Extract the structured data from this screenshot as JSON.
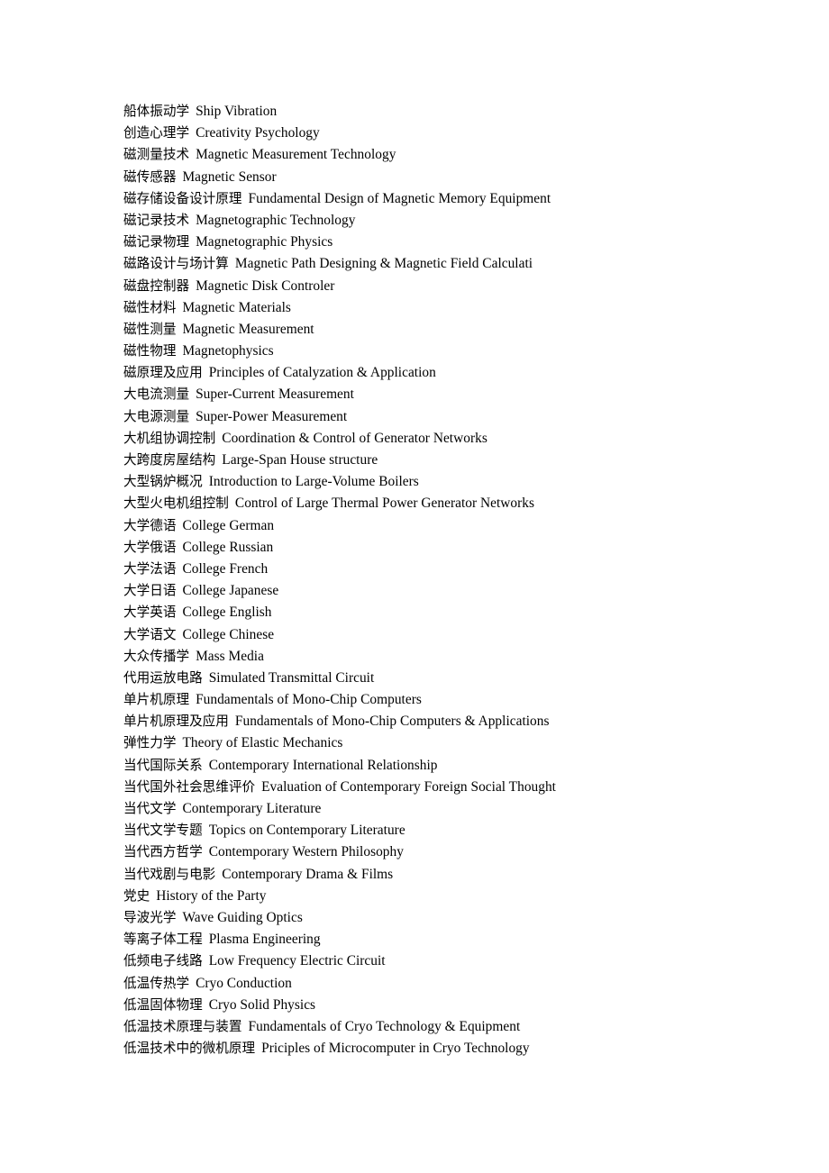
{
  "document": {
    "type": "bilingual-glossary",
    "page_background": "#ffffff",
    "text_color": "#000000",
    "entries": [
      {
        "zh": "船体振动学",
        "en": "Ship Vibration"
      },
      {
        "zh": "创造心理学",
        "en": "Creativity Psychology"
      },
      {
        "zh": "磁测量技术",
        "en": "Magnetic Measurement Technology"
      },
      {
        "zh": "磁传感器",
        "en": "Magnetic Sensor"
      },
      {
        "zh": "磁存储设备设计原理",
        "en": "Fundamental Design of Magnetic Memory Equipment"
      },
      {
        "zh": "磁记录技术",
        "en": "Magnetographic Technology"
      },
      {
        "zh": "磁记录物理",
        "en": "Magnetographic Physics"
      },
      {
        "zh": "磁路设计与场计算",
        "en": "Magnetic Path Designing & Magnetic Field Calculati"
      },
      {
        "zh": "磁盘控制器",
        "en": "Magnetic Disk Controler"
      },
      {
        "zh": "磁性材料",
        "en": "Magnetic Materials"
      },
      {
        "zh": "磁性测量",
        "en": "Magnetic Measurement"
      },
      {
        "zh": "磁性物理",
        "en": "Magnetophysics"
      },
      {
        "zh": "磁原理及应用",
        "en": "Principles of Catalyzation & Application"
      },
      {
        "zh": "大电流测量",
        "en": "Super-Current Measurement"
      },
      {
        "zh": "大电源测量",
        "en": "Super-Power Measurement"
      },
      {
        "zh": "大机组协调控制",
        "en": "Coordination & Control of Generator Networks"
      },
      {
        "zh": "大跨度房屋结构",
        "en": "Large-Span House structure"
      },
      {
        "zh": "大型锅炉概况",
        "en": "Introduction to Large-Volume Boilers"
      },
      {
        "zh": "大型火电机组控制",
        "en": "Control of Large Thermal Power Generator Networks"
      },
      {
        "zh": "大学德语",
        "en": "College German"
      },
      {
        "zh": "大学俄语",
        "en": "College Russian"
      },
      {
        "zh": "大学法语",
        "en": "College French"
      },
      {
        "zh": "大学日语",
        "en": "College Japanese"
      },
      {
        "zh": "大学英语",
        "en": "College English"
      },
      {
        "zh": "大学语文",
        "en": "College Chinese"
      },
      {
        "zh": "大众传播学",
        "en": "Mass Media"
      },
      {
        "zh": "代用运放电路",
        "en": "Simulated Transmittal Circuit"
      },
      {
        "zh": "单片机原理",
        "en": "Fundamentals of Mono-Chip Computers"
      },
      {
        "zh": "单片机原理及应用",
        "en": "Fundamentals of Mono-Chip Computers & Applications"
      },
      {
        "zh": "弹性力学",
        "en": "Theory of Elastic Mechanics"
      },
      {
        "zh": "当代国际关系",
        "en": "Contemporary International Relationship"
      },
      {
        "zh": "当代国外社会思维评价",
        "en": "Evaluation of Contemporary Foreign Social Thought"
      },
      {
        "zh": "当代文学",
        "en": "Contemporary Literature"
      },
      {
        "zh": "当代文学专题",
        "en": "Topics on Contemporary Literature"
      },
      {
        "zh": "当代西方哲学",
        "en": "Contemporary Western Philosophy"
      },
      {
        "zh": "当代戏剧与电影",
        "en": "Contemporary Drama & Films"
      },
      {
        "zh": "党史",
        "en": "History of the Party"
      },
      {
        "zh": "导波光学",
        "en": "Wave Guiding Optics"
      },
      {
        "zh": "等离子体工程",
        "en": "Plasma Engineering"
      },
      {
        "zh": "低频电子线路",
        "en": "Low Frequency Electric Circuit"
      },
      {
        "zh": "低温传热学",
        "en": "Cryo Conduction"
      },
      {
        "zh": "低温固体物理",
        "en": "Cryo Solid Physics"
      },
      {
        "zh": "低温技术原理与装置",
        "en": "Fundamentals of Cryo Technology & Equipment"
      },
      {
        "zh": "低温技术中的微机原理",
        "en": "Priciples of Microcomputer in Cryo Technology"
      }
    ]
  }
}
